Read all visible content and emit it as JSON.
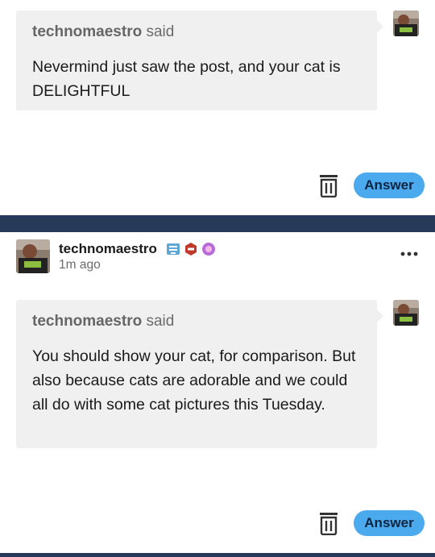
{
  "posts": [
    {
      "ask": {
        "asker": "technomaestro",
        "said": " said",
        "message": "Nevermind just saw the post, and your cat is DELIGHTFUL"
      },
      "answer_label": "Answer"
    },
    {
      "author": "technomaestro",
      "time": "1m ago",
      "ask": {
        "asker": "technomaestro",
        "said": " said",
        "message": "You should show your cat, for comparison. But also because cats are adorable and we could all do with some cat pictures this Tuesday."
      },
      "answer_label": "Answer"
    }
  ],
  "icons": {
    "delete": "trash-icon",
    "more": "more-options-icon",
    "badges": [
      "tumblr-sticker-badge",
      "hexagon-badge",
      "brain-badge"
    ]
  },
  "colors": {
    "accent": "#4ba9ee",
    "divider": "#283a59",
    "bubble": "#f0f0f0"
  }
}
